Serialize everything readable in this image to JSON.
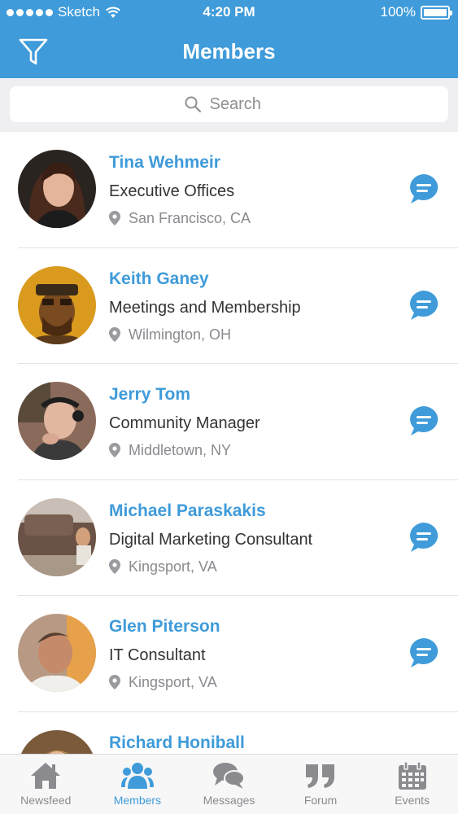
{
  "status_bar": {
    "carrier": "Sketch",
    "time": "4:20 PM",
    "battery": "100%"
  },
  "header": {
    "title": "Members"
  },
  "search": {
    "placeholder": "Search"
  },
  "members": [
    {
      "name": "Tina Wehmeir",
      "role": "Executive Offices",
      "location": "San Francisco, CA"
    },
    {
      "name": "Keith Ganey",
      "role": "Meetings and Membership",
      "location": "Wilmington, OH"
    },
    {
      "name": "Jerry Tom",
      "role": "Community Manager",
      "location": "Middletown, NY"
    },
    {
      "name": "Michael Paraskakis",
      "role": "Digital Marketing Consultant",
      "location": "Kingsport, VA"
    },
    {
      "name": "Glen Piterson",
      "role": "IT Consultant",
      "location": "Kingsport, VA"
    },
    {
      "name": "Richard Honiball",
      "role": "",
      "location": ""
    }
  ],
  "tabs": [
    {
      "label": "Newsfeed",
      "icon": "home-icon",
      "active": false
    },
    {
      "label": "Members",
      "icon": "members-icon",
      "active": true
    },
    {
      "label": "Messages",
      "icon": "messages-icon",
      "active": false
    },
    {
      "label": "Forum",
      "icon": "quote-icon",
      "active": false
    },
    {
      "label": "Events",
      "icon": "calendar-icon",
      "active": false
    }
  ],
  "colors": {
    "accent": "#3f9bd9",
    "tab_inactive": "#8a8a8f",
    "search_bg": "#efeff1"
  }
}
